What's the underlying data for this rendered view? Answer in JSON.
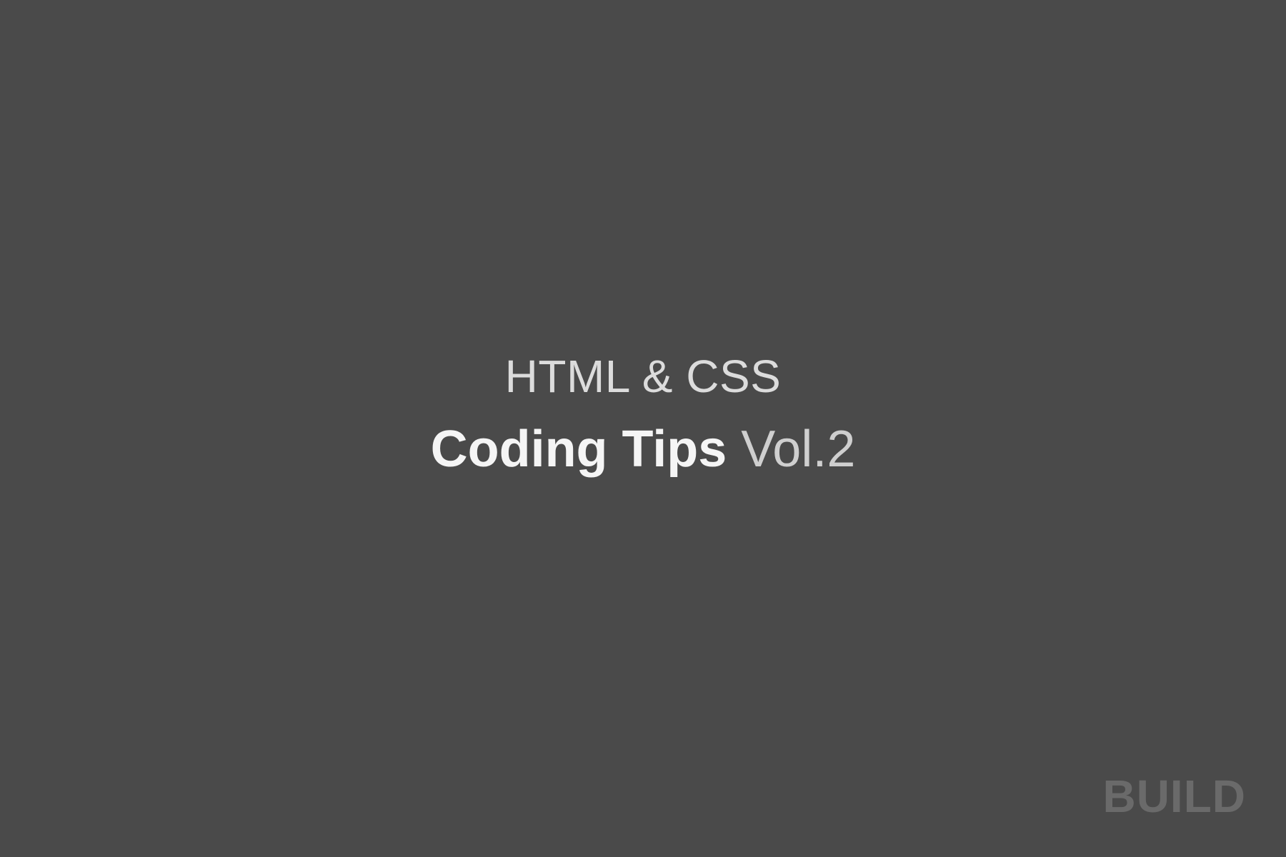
{
  "title": {
    "line1": "HTML & CSS",
    "line2_bold": "Coding Tips",
    "line2_light": " Vol.2"
  },
  "watermark": "BUILD",
  "colors": {
    "background": "#4a4a4a",
    "text_primary": "#f5f5f5",
    "text_secondary": "#dcdcdc",
    "watermark": "#6a6a6a"
  }
}
